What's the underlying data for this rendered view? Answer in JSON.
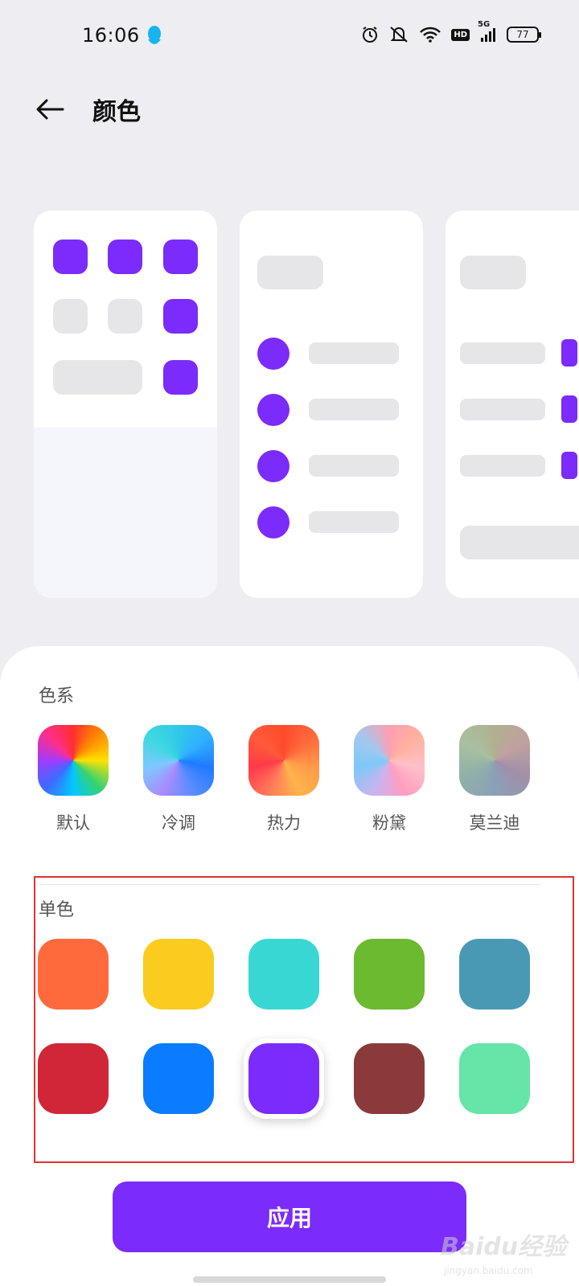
{
  "status_bar": {
    "time": "16:06",
    "network": "5G",
    "hd": "HD",
    "battery": "77"
  },
  "header": {
    "title": "颜色"
  },
  "colors": {
    "accent": "#7b2bfb",
    "highlight_border": "#e0332c"
  },
  "palette_section": {
    "label": "色系",
    "items": [
      {
        "label": "默认"
      },
      {
        "label": "冷调"
      },
      {
        "label": "热力"
      },
      {
        "label": "粉黛"
      },
      {
        "label": "莫兰迪"
      }
    ]
  },
  "solid_section": {
    "label": "单色",
    "rows": [
      [
        "#ff6a3c",
        "#fccb1f",
        "#38d7d4",
        "#6bba2f",
        "#4a99b4"
      ],
      [
        "#d02638",
        "#0a7cff",
        "#7b2bfb",
        "#8a3a3a",
        "#65e5a8"
      ]
    ],
    "selected": "#7b2bfb"
  },
  "apply_button": {
    "label": "应用"
  },
  "watermark": {
    "text": "Baidu经验",
    "sub": "jingyan.baidu.com"
  }
}
